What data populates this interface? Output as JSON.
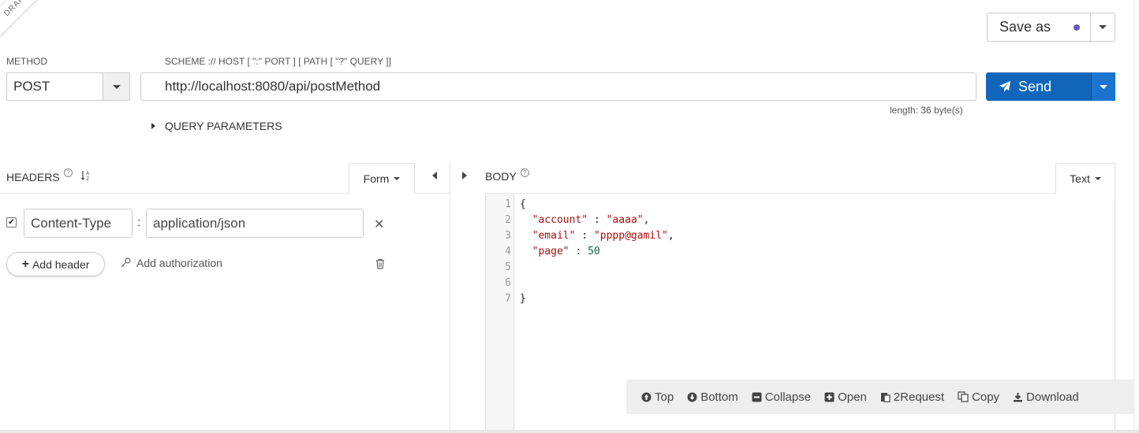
{
  "draft_label": "DRAFT",
  "save_as": {
    "label": "Save as",
    "dot_color": "#6a5acd"
  },
  "method": {
    "label": "METHOD",
    "value": "POST"
  },
  "url": {
    "label": "SCHEME :// HOST [ \":\" PORT ] [ PATH [ \"?\" QUERY ]]",
    "value": "http://localhost:8080/api/postMethod",
    "length": "length: 36 byte(s)"
  },
  "send": {
    "label": "Send",
    "color": "#1166bb"
  },
  "query_params": {
    "label": "QUERY PARAMETERS"
  },
  "headers": {
    "title": "HEADERS",
    "help": "?",
    "sort_icon": "A↓Z",
    "mode": "Form",
    "rows": [
      {
        "checked": true,
        "name": "Content-Type",
        "value": "application/json"
      }
    ],
    "separator": ":",
    "add_header": "Add header",
    "add_authorization": "Add authorization"
  },
  "body": {
    "title": "BODY",
    "help": "?",
    "mode": "Text",
    "line_numbers": [
      "1",
      "2",
      "3",
      "4",
      "5",
      "6",
      "7"
    ],
    "lines": [
      {
        "parts": [
          {
            "t": "{",
            "c": ""
          }
        ]
      },
      {
        "parts": [
          {
            "t": "  ",
            "c": ""
          },
          {
            "t": "\"account\"",
            "c": "k"
          },
          {
            "t": " : ",
            "c": ""
          },
          {
            "t": "\"aaaa\"",
            "c": "s"
          },
          {
            "t": ",",
            "c": ""
          }
        ]
      },
      {
        "parts": [
          {
            "t": "  ",
            "c": ""
          },
          {
            "t": "\"email\"",
            "c": "k"
          },
          {
            "t": " : ",
            "c": ""
          },
          {
            "t": "\"pppp@gamil\"",
            "c": "s"
          },
          {
            "t": ",",
            "c": ""
          }
        ]
      },
      {
        "parts": [
          {
            "t": "  ",
            "c": ""
          },
          {
            "t": "\"page\"",
            "c": "k"
          },
          {
            "t": " : ",
            "c": ""
          },
          {
            "t": "50",
            "c": "n"
          }
        ]
      },
      {
        "parts": [
          {
            "t": "",
            "c": ""
          }
        ]
      },
      {
        "parts": [
          {
            "t": "",
            "c": ""
          }
        ]
      },
      {
        "parts": [
          {
            "t": "}",
            "c": ""
          }
        ]
      }
    ]
  },
  "toolbar": {
    "top": "Top",
    "bottom": "Bottom",
    "collapse": "Collapse",
    "open": "Open",
    "to_request": "2Request",
    "copy": "Copy",
    "download": "Download"
  }
}
